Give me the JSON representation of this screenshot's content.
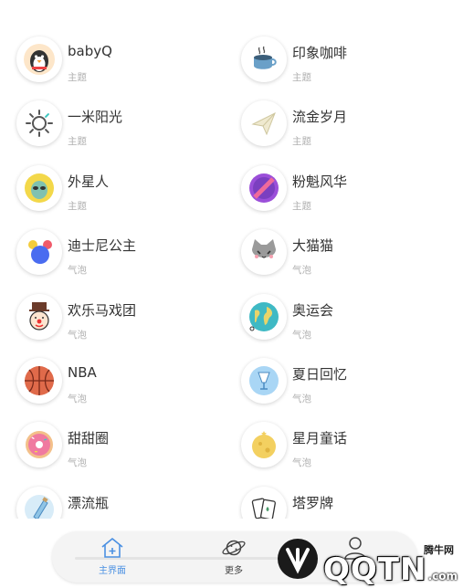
{
  "themes": [
    {
      "name": "babyQ",
      "category": "主题",
      "icon": "penguin-icon",
      "color": "#f7d9b5"
    },
    {
      "name": "印象咖啡",
      "category": "主题",
      "icon": "coffee-cup-icon",
      "color": "#6aa0c8"
    },
    {
      "name": "一米阳光",
      "category": "主题",
      "icon": "sun-icon",
      "color": "#555555"
    },
    {
      "name": "流金岁月",
      "category": "主题",
      "icon": "paper-plane-icon",
      "color": "#e9e3c8"
    },
    {
      "name": "外星人",
      "category": "主题",
      "icon": "alien-icon",
      "color": "#f3d84a"
    },
    {
      "name": "粉魁风华",
      "category": "主题",
      "icon": "striped-ball-icon",
      "color": "#9b4fd9"
    },
    {
      "name": "迪士尼公主",
      "category": "气泡",
      "icon": "bubbles-icon",
      "color": "#4a6cf0"
    },
    {
      "name": "大猫猫",
      "category": "气泡",
      "icon": "cat-icon",
      "color": "#8c8c8c"
    },
    {
      "name": "欢乐马戏团",
      "category": "气泡",
      "icon": "clown-icon",
      "color": "#e04848"
    },
    {
      "name": "奥运会",
      "category": "气泡",
      "icon": "globe-icon",
      "color": "#3fb9c4"
    },
    {
      "name": "NBA",
      "category": "气泡",
      "icon": "basketball-icon",
      "color": "#e06a4a"
    },
    {
      "name": "夏日回忆",
      "category": "气泡",
      "icon": "drink-glass-icon",
      "color": "#a9d6f5"
    },
    {
      "name": "甜甜圈",
      "category": "气泡",
      "icon": "donut-icon",
      "color": "#f07aa0"
    },
    {
      "name": "星月童话",
      "category": "气泡",
      "icon": "moon-icon",
      "color": "#f3d060"
    },
    {
      "name": "漂流瓶",
      "category": "气泡",
      "icon": "bottle-icon",
      "color": "#8fc4e6"
    },
    {
      "name": "塔罗牌",
      "category": "气泡",
      "icon": "tarot-cards-icon",
      "color": "#4a9a6a"
    }
  ],
  "bottom_nav": {
    "items": [
      {
        "label": "主界面",
        "icon": "home-icon",
        "active": true
      },
      {
        "label": "更多",
        "icon": "planet-icon",
        "active": false
      },
      {
        "label": "",
        "icon": "user-icon",
        "active": false
      }
    ],
    "accent": "#4a90e2"
  },
  "watermark": {
    "site_cn": "腾牛网",
    "logo_text": "QQTN",
    "suffix": ".com"
  }
}
